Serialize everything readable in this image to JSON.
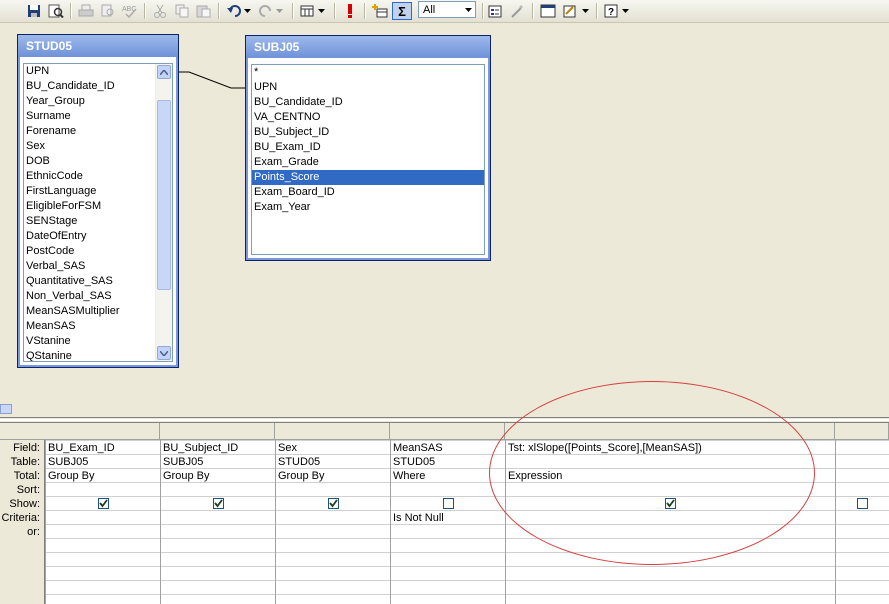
{
  "toolbar": {
    "totals_combo_value": "All",
    "sigma_label": "Σ"
  },
  "tables": [
    {
      "title": "STUD05",
      "fields": [
        "UPN",
        "BU_Candidate_ID",
        "Year_Group",
        "Surname",
        "Forename",
        "Sex",
        "DOB",
        "EthnicCode",
        "FirstLanguage",
        "EligibleForFSM",
        "SENStage",
        "DateOfEntry",
        "PostCode",
        "Verbal_SAS",
        "Quantitative_SAS",
        "Non_Verbal_SAS",
        "MeanSASMultiplier",
        "MeanSAS",
        "VStanine",
        "QStanine"
      ]
    },
    {
      "title": "SUBJ05",
      "fields": [
        "*",
        "UPN",
        "BU_Candidate_ID",
        "VA_CENTNO",
        "BU_Subject_ID",
        "BU_Exam_ID",
        "Exam_Grade",
        "Points_Score",
        "Exam_Board_ID",
        "Exam_Year"
      ],
      "selected": "Points_Score"
    }
  ],
  "grid": {
    "row_labels": [
      "Field:",
      "Table:",
      "Total:",
      "Sort:",
      "Show:",
      "Criteria:",
      "or:"
    ],
    "columns": [
      {
        "field": "BU_Exam_ID",
        "table": "SUBJ05",
        "total": "Group By",
        "sort": "",
        "show": true,
        "criteria": ""
      },
      {
        "field": "BU_Subject_ID",
        "table": "SUBJ05",
        "total": "Group By",
        "sort": "",
        "show": true,
        "criteria": ""
      },
      {
        "field": "Sex",
        "table": "STUD05",
        "total": "Group By",
        "sort": "",
        "show": true,
        "criteria": ""
      },
      {
        "field": "MeanSAS",
        "table": "STUD05",
        "total": "Where",
        "sort": "",
        "show": false,
        "criteria": "Is Not Null"
      },
      {
        "field": "Tst: xlSlope([Points_Score],[MeanSAS])",
        "table": "",
        "total": "Expression",
        "sort": "",
        "show": true,
        "criteria": ""
      },
      {
        "field": "",
        "table": "",
        "total": "",
        "sort": "",
        "show": false,
        "criteria": ""
      }
    ]
  },
  "annotation": {
    "color": "#d64040",
    "shape": "ellipse"
  }
}
